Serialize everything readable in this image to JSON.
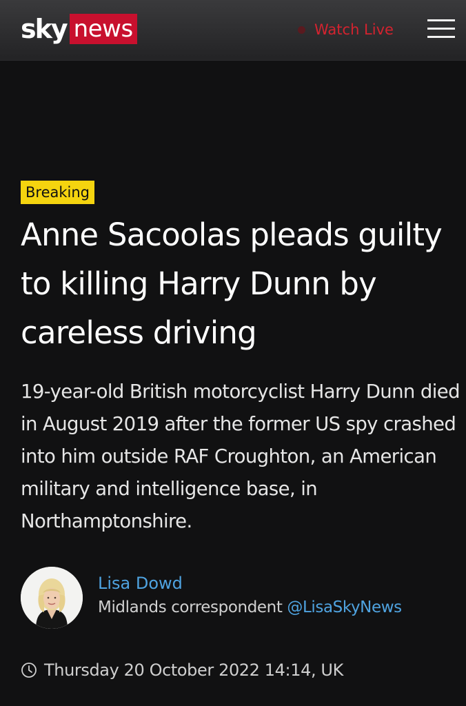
{
  "header": {
    "logo_sky": "sky",
    "logo_news": "news",
    "watch_live_label": "Watch Live",
    "menu_icon": "hamburger-menu-icon",
    "brand_red": "#c8102e"
  },
  "article": {
    "badge": "Breaking",
    "badge_color": "#f5d40f",
    "headline": "Anne Sacoolas pleads guilty to killing Harry Dunn by careless driving",
    "standfirst": "19-year-old British motorcyclist Harry Dunn died in August 2019 after the former US spy crashed into him outside RAF Croughton, an American military and intelligence base, in Northamptonshire."
  },
  "author": {
    "name": "Lisa Dowd",
    "role": "Midlands correspondent",
    "handle": "@LisaSkyNews",
    "link_color": "#4fa3e0"
  },
  "meta": {
    "timestamp": "Thursday 20 October 2022 14:14, UK",
    "clock_icon": "clock-icon"
  }
}
